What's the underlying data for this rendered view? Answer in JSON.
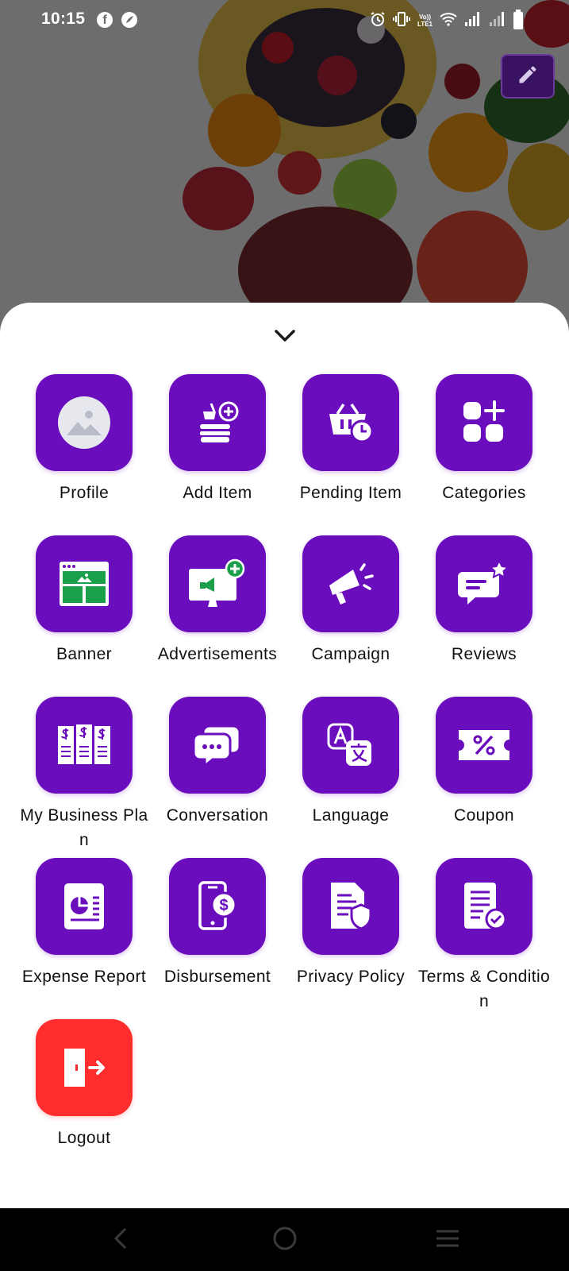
{
  "status_bar": {
    "time": "10:15",
    "facebook_icon": "f",
    "lte_label_top": "Vo))",
    "lte_label_bottom": "LTE1"
  },
  "colors": {
    "tile_purple": "#6a0dbd",
    "logout_red": "#ff2d2d",
    "edit_button_bg": "#3a1262"
  },
  "menu": {
    "items": [
      {
        "label": "Profile",
        "icon": "profile-image-icon"
      },
      {
        "label": "Add Item",
        "icon": "add-item-icon"
      },
      {
        "label": "Pending Item",
        "icon": "pending-basket-icon"
      },
      {
        "label": "Categories",
        "icon": "categories-icon"
      },
      {
        "label": "Banner",
        "icon": "banner-icon"
      },
      {
        "label": "Advertisements",
        "icon": "advertisement-icon"
      },
      {
        "label": "Campaign",
        "icon": "megaphone-icon"
      },
      {
        "label": "Reviews",
        "icon": "review-star-icon"
      },
      {
        "label": "My Business Plan",
        "icon": "business-plan-icon"
      },
      {
        "label": "Conversation",
        "icon": "chat-bubbles-icon"
      },
      {
        "label": "Language",
        "icon": "translate-icon"
      },
      {
        "label": "Coupon",
        "icon": "coupon-icon"
      },
      {
        "label": "Expense Report",
        "icon": "expense-report-icon"
      },
      {
        "label": "Disbursement",
        "icon": "phone-payment-icon"
      },
      {
        "label": "Privacy Policy",
        "icon": "privacy-document-icon"
      },
      {
        "label": "Terms & Condition",
        "icon": "terms-check-icon"
      },
      {
        "label": "Logout",
        "icon": "logout-door-icon"
      }
    ]
  }
}
